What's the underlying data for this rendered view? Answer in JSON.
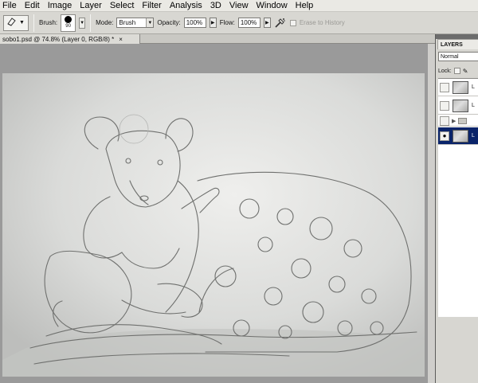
{
  "menu": [
    "File",
    "Edit",
    "Image",
    "Layer",
    "Select",
    "Filter",
    "Analysis",
    "3D",
    "View",
    "Window",
    "Help"
  ],
  "options": {
    "brush_label": "Brush:",
    "brush_size": "90",
    "mode_label": "Mode:",
    "mode_value": "Brush",
    "opacity_label": "Opacity:",
    "opacity_value": "100%",
    "flow_label": "Flow:",
    "flow_value": "100%",
    "erase_history": "Erase to History"
  },
  "document": {
    "tab_title": "sobo1.psd @ 74.8% (Layer 0, RGB/8) *",
    "close_glyph": "×"
  },
  "layers_panel": {
    "title": "LAYERS",
    "blend_mode": "Normal",
    "lock_label": "Lock:",
    "layers": [
      {
        "name": "L",
        "visible": false,
        "selected": false,
        "type": "layer"
      },
      {
        "name": "L",
        "visible": false,
        "selected": false,
        "type": "layer"
      },
      {
        "name": "",
        "visible": false,
        "selected": false,
        "type": "group"
      },
      {
        "name": "L",
        "visible": true,
        "selected": true,
        "type": "layer"
      }
    ]
  },
  "icons": {
    "eraser": "eraser-icon",
    "airbrush": "airbrush-icon",
    "eye": "eye-icon",
    "folder": "folder-icon",
    "lock_transparent": "lock-transparent-icon",
    "lock_brush": "lock-brush-icon"
  },
  "colors": {
    "selected_layer": "#0a246a",
    "menubar": "#eae9e4",
    "canvas_paper": "#d7d8d6"
  }
}
